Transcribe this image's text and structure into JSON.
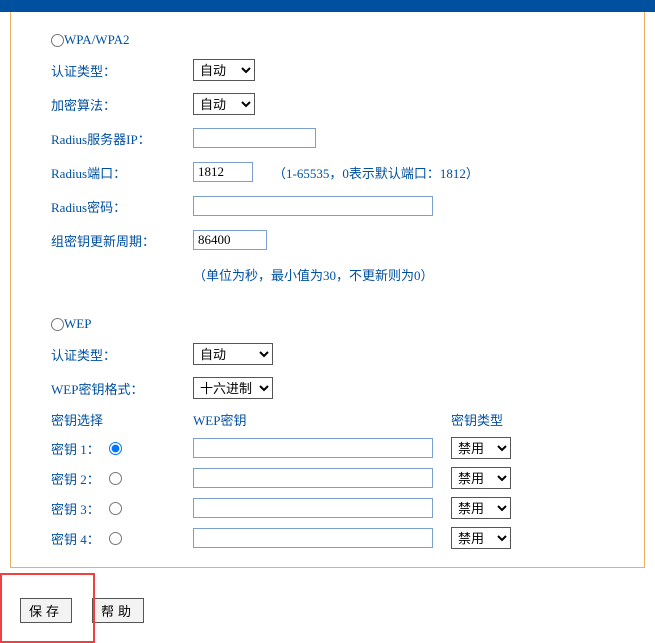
{
  "wpa": {
    "title": "WPA/WPA2",
    "auth_label": "认证类型：",
    "auth_value": "自动",
    "encrypt_label": "加密算法：",
    "encrypt_value": "自动",
    "radius_ip_label": "Radius服务器IP：",
    "radius_ip_value": "",
    "radius_port_label": "Radius端口：",
    "radius_port_value": "1812",
    "radius_port_hint": "（1-65535，0表示默认端口：1812）",
    "radius_pw_label": "Radius密码：",
    "radius_pw_value": "",
    "group_key_label": "组密钥更新周期：",
    "group_key_value": "86400",
    "group_key_hint": "（单位为秒，最小值为30，不更新则为0）"
  },
  "wep": {
    "title": "WEP",
    "auth_label": "认证类型：",
    "auth_value": "自动",
    "format_label": "WEP密钥格式：",
    "format_value": "十六进制",
    "col_select": "密钥选择",
    "col_key": "WEP密钥",
    "col_type": "密钥类型",
    "keys": [
      {
        "label": "密钥 1：",
        "value": "",
        "type": "禁用"
      },
      {
        "label": "密钥 2：",
        "value": "",
        "type": "禁用"
      },
      {
        "label": "密钥 3：",
        "value": "",
        "type": "禁用"
      },
      {
        "label": "密钥 4：",
        "value": "",
        "type": "禁用"
      }
    ]
  },
  "buttons": {
    "save": "保存",
    "help": "帮助"
  }
}
